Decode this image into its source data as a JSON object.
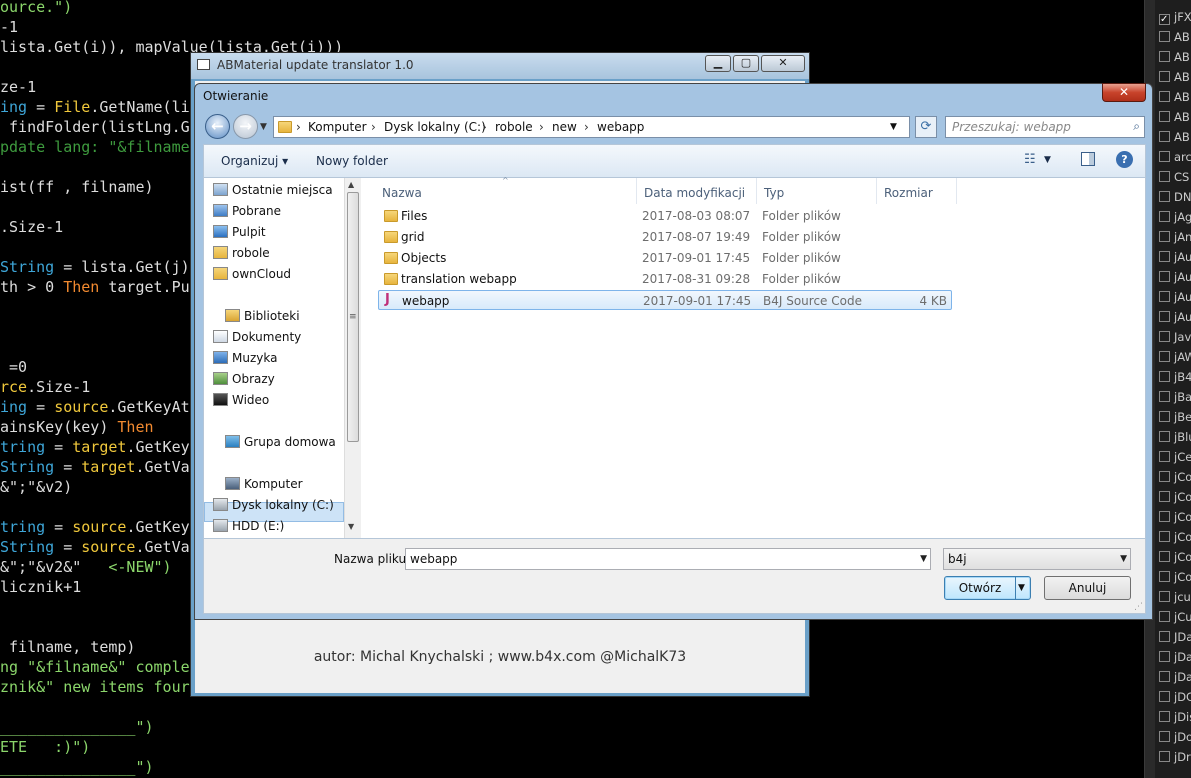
{
  "code_lines": [
    [
      [
        "str",
        "ource.\")"
      ]
    ],
    [
      [
        "",
        "-1"
      ]
    ],
    [
      [
        "",
        "lista.Get(i)), mapValue(lista.Get(i)))"
      ]
    ],
    [
      [
        "",
        ""
      ]
    ],
    [
      [
        "",
        "ze-1"
      ]
    ],
    [
      [
        "ty",
        "ing"
      ],
      [
        "",
        " = "
      ],
      [
        "fn",
        "File"
      ],
      [
        "",
        ".GetName(li"
      ]
    ],
    [
      [
        "",
        " findFolder(listLng.G"
      ]
    ],
    [
      [
        "cm",
        "pdate lang: \"&filname"
      ]
    ],
    [
      [
        "",
        ""
      ]
    ],
    [
      [
        "",
        "ist(ff , filname)"
      ]
    ],
    [
      [
        "",
        ""
      ]
    ],
    [
      [
        "",
        ".Size-1"
      ]
    ],
    [
      [
        "",
        ""
      ]
    ],
    [
      [
        "ty",
        "String"
      ],
      [
        "",
        " = lista.Get(j)"
      ]
    ],
    [
      [
        "",
        "th > 0 "
      ],
      [
        "kw",
        "Then"
      ],
      [
        "",
        " target.Pu"
      ]
    ],
    [
      [
        "",
        ""
      ]
    ],
    [
      [
        "",
        ""
      ]
    ],
    [
      [
        "",
        ""
      ]
    ],
    [
      [
        "",
        " =0"
      ]
    ],
    [
      [
        "fn",
        "rce"
      ],
      [
        "",
        ".Size-1"
      ]
    ],
    [
      [
        "ty",
        "ing"
      ],
      [
        "",
        " = "
      ],
      [
        "fn",
        "source"
      ],
      [
        "",
        ".GetKeyAt"
      ]
    ],
    [
      [
        "",
        "ainsKey(key) "
      ],
      [
        "kw",
        "Then"
      ]
    ],
    [
      [
        "ty",
        "tring"
      ],
      [
        "",
        " = "
      ],
      [
        "fn",
        "target"
      ],
      [
        "",
        ".GetKey"
      ]
    ],
    [
      [
        "ty",
        "String"
      ],
      [
        "",
        " = "
      ],
      [
        "fn",
        "target"
      ],
      [
        "",
        ".GetVa"
      ]
    ],
    [
      [
        "",
        "&\";\"&v2)"
      ]
    ],
    [
      [
        "",
        ""
      ]
    ],
    [
      [
        "ty",
        "tring"
      ],
      [
        "",
        " = "
      ],
      [
        "fn",
        "source"
      ],
      [
        "",
        ".GetKey"
      ]
    ],
    [
      [
        "ty",
        "String"
      ],
      [
        "",
        " = "
      ],
      [
        "fn",
        "source"
      ],
      [
        "",
        ".GetVa"
      ]
    ],
    [
      [
        "",
        "&\";\"&v2&\"   "
      ],
      [
        "str",
        "<-NEW\")"
      ]
    ],
    [
      [
        "",
        "licznik+1"
      ]
    ],
    [
      [
        "",
        ""
      ]
    ],
    [
      [
        "",
        ""
      ]
    ],
    [
      [
        "",
        " filname, temp)"
      ]
    ],
    [
      [
        "str",
        "ng \"&filname&\" comple"
      ]
    ],
    [
      [
        "str",
        "znik&\" new items four"
      ]
    ],
    [
      [
        "",
        ""
      ]
    ],
    [
      [
        "str",
        "_______________\")"
      ]
    ],
    [
      [
        "str",
        "ETE   :)\")"
      ]
    ],
    [
      [
        "str",
        "_______________\")"
      ]
    ]
  ],
  "right_panel": {
    "items": [
      {
        "label": "jFX",
        "checked": true
      },
      {
        "label": "AB",
        "checked": false
      },
      {
        "label": "AB",
        "checked": false
      },
      {
        "label": "AB",
        "checked": false
      },
      {
        "label": "AB",
        "checked": false
      },
      {
        "label": "AB",
        "checked": false
      },
      {
        "label": "AB",
        "checked": false
      },
      {
        "label": "arc",
        "checked": false
      },
      {
        "label": "CS",
        "checked": false
      },
      {
        "label": "DN",
        "checked": false
      },
      {
        "label": "jAg",
        "checked": false
      },
      {
        "label": "jAn",
        "checked": false
      },
      {
        "label": "jAu",
        "checked": false
      },
      {
        "label": "jAu",
        "checked": false
      },
      {
        "label": "jAu",
        "checked": false
      },
      {
        "label": "jAu",
        "checked": false
      },
      {
        "label": "Jav",
        "checked": false
      },
      {
        "label": "jAW",
        "checked": false
      },
      {
        "label": "jB4",
        "checked": false
      },
      {
        "label": "jBa",
        "checked": false
      },
      {
        "label": "jBe",
        "checked": false
      },
      {
        "label": "jBlu",
        "checked": false
      },
      {
        "label": "jCe",
        "checked": false
      },
      {
        "label": "jCo",
        "checked": false
      },
      {
        "label": "jCo",
        "checked": false
      },
      {
        "label": "jCo",
        "checked": false
      },
      {
        "label": "jCo",
        "checked": false
      },
      {
        "label": "jCo",
        "checked": false
      },
      {
        "label": "jCo",
        "checked": false
      },
      {
        "label": "jcu",
        "checked": false
      },
      {
        "label": "jCu",
        "checked": false
      },
      {
        "label": "JDa",
        "checked": false
      },
      {
        "label": "jDa",
        "checked": false
      },
      {
        "label": "jDa",
        "checked": false
      },
      {
        "label": "jDG",
        "checked": false
      },
      {
        "label": "jDis",
        "checked": false
      },
      {
        "label": "jDo",
        "checked": false
      },
      {
        "label": "jDr",
        "checked": false
      }
    ]
  },
  "translator": {
    "title": "ABMaterial update translator 1.0",
    "author": "autor: Michal Knychalski ; www.b4x.com @MichalK73"
  },
  "dialog": {
    "title": "Otwieranie",
    "close_glyph": "✕",
    "breadcrumb": [
      "Komputer",
      "Dysk lokalny (C:)",
      "robole",
      "new",
      "webapp"
    ],
    "search_placeholder": "Przeszukaj: webapp",
    "toolbar": {
      "organize": "Organizuj ▾",
      "new_folder": "Nowy folder"
    },
    "nav_items": [
      {
        "label": "Ostatnie miejsca",
        "icon": "recent-places-icon"
      },
      {
        "label": "Pobrane",
        "icon": "downloads-folder-icon"
      },
      {
        "label": "Pulpit",
        "icon": "desktop-folder-icon"
      },
      {
        "label": "robole",
        "icon": "folder-icon"
      },
      {
        "label": "ownCloud",
        "icon": "folder-icon"
      },
      {
        "label": "Biblioteki",
        "icon": "libraries-icon"
      },
      {
        "label": "Dokumenty",
        "icon": "documents-icon"
      },
      {
        "label": "Muzyka",
        "icon": "music-icon"
      },
      {
        "label": "Obrazy",
        "icon": "pictures-icon"
      },
      {
        "label": "Wideo",
        "icon": "video-icon"
      },
      {
        "label": "Grupa domowa",
        "icon": "homegroup-icon"
      },
      {
        "label": "Komputer",
        "icon": "computer-icon"
      },
      {
        "label": "Dysk lokalny (C:)",
        "icon": "drive-icon"
      },
      {
        "label": "HDD (E:)",
        "icon": "drive-icon"
      }
    ],
    "columns": [
      "Nazwa",
      "Data modyfikacji",
      "Typ",
      "Rozmiar"
    ],
    "files": [
      {
        "name": "Files",
        "date": "2017-08-03 08:07",
        "type": "Folder plików",
        "size": "",
        "kind": "folder"
      },
      {
        "name": "grid",
        "date": "2017-08-07 19:49",
        "type": "Folder plików",
        "size": "",
        "kind": "folder"
      },
      {
        "name": "Objects",
        "date": "2017-09-01 17:45",
        "type": "Folder plików",
        "size": "",
        "kind": "folder"
      },
      {
        "name": "translation webapp",
        "date": "2017-08-31 09:28",
        "type": "Folder plików",
        "size": "",
        "kind": "folder"
      },
      {
        "name": "webapp",
        "date": "2017-09-01 17:45",
        "type": "B4J Source Code",
        "size": "4 KB",
        "kind": "b4j",
        "selected": true
      }
    ],
    "filename_label": "Nazwa pliku:",
    "filename_value": "webapp",
    "filter_value": "b4j",
    "open_button": "Otwórz",
    "cancel_button": "Anuluj"
  }
}
